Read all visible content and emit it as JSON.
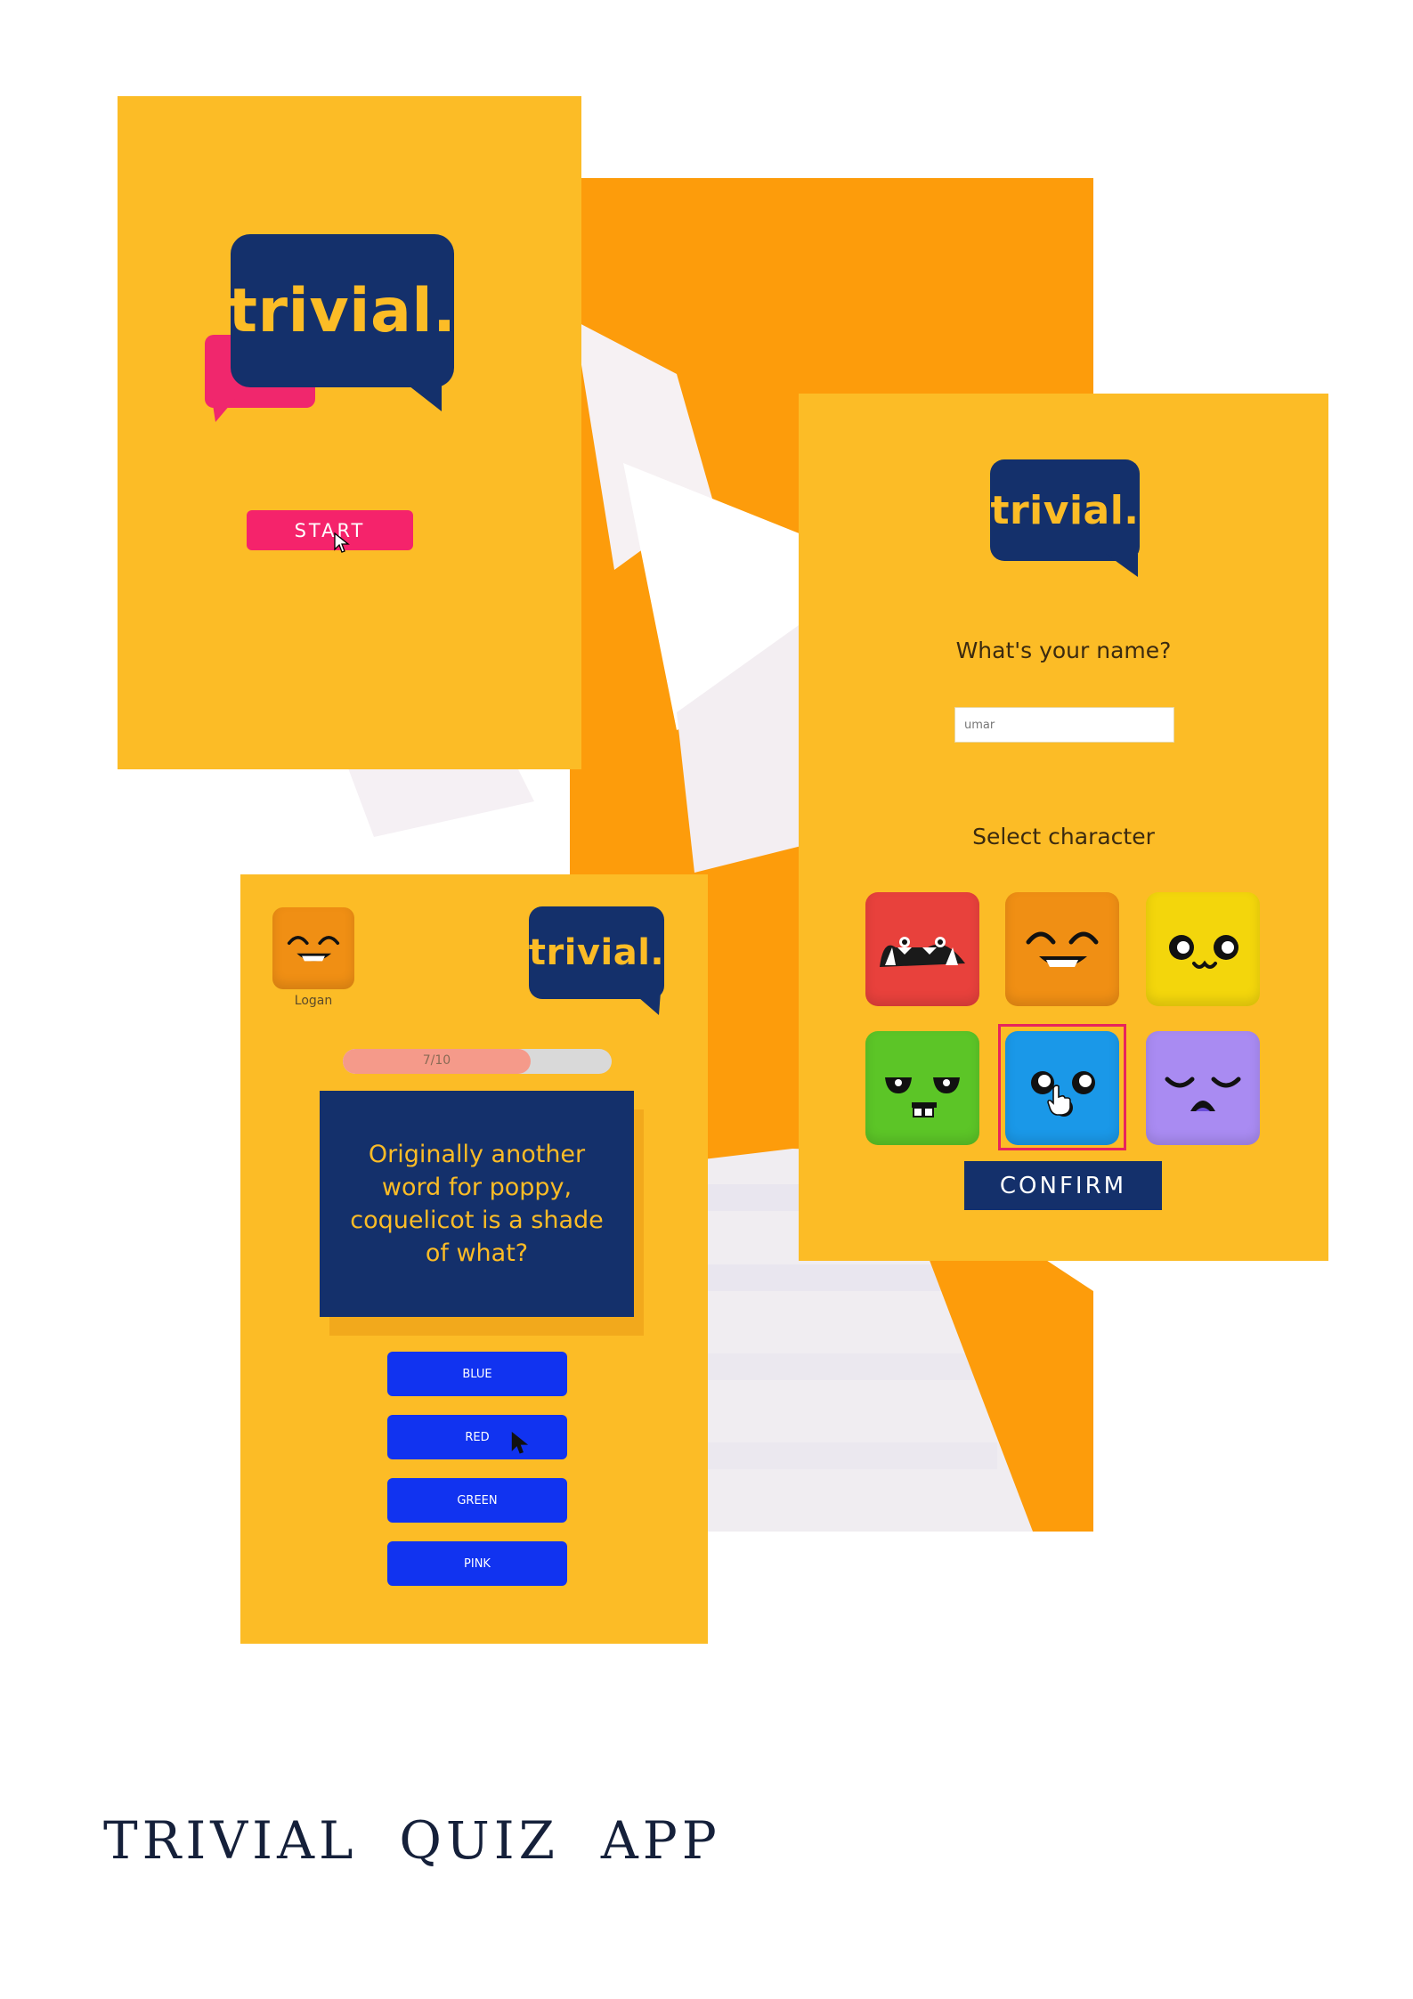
{
  "colors": {
    "screen_bg": "#fcbc26",
    "navy": "#14306b",
    "pink": "#f5236b",
    "answer_blue": "#1133f0",
    "backdrop_orange": "#fd9c0b"
  },
  "start_screen": {
    "logo_text": "trivial.",
    "start_label": "START"
  },
  "setup_screen": {
    "logo_text": "trivial.",
    "name_prompt": "What's your name?",
    "name_value": "umar",
    "select_prompt": "Select character",
    "characters": [
      {
        "icon": "red-monster-face-icon",
        "color": "#e8413c"
      },
      {
        "icon": "orange-grin-face-icon",
        "color": "#f08f14"
      },
      {
        "icon": "yellow-smile-face-icon",
        "color": "#f3d60c"
      },
      {
        "icon": "green-zombie-face-icon",
        "color": "#5cc527"
      },
      {
        "icon": "blue-surprised-face-icon",
        "color": "#1a98e8",
        "selected": true
      },
      {
        "icon": "purple-sad-face-icon",
        "color": "#a98bf2"
      }
    ],
    "confirm_label": "CONFIRM"
  },
  "quiz_screen": {
    "logo_text": "trivial.",
    "player_name": "Logan",
    "player_avatar": "orange-grin-face-icon",
    "progress_text": "7/10",
    "progress_value": 0.7,
    "question": "Originally another word for poppy, coquelicot is a shade of what?",
    "answers": [
      "BLUE",
      "RED",
      "GREEN",
      "PINK"
    ]
  },
  "page_title": "TRIVIAL  QUIZ  APP"
}
